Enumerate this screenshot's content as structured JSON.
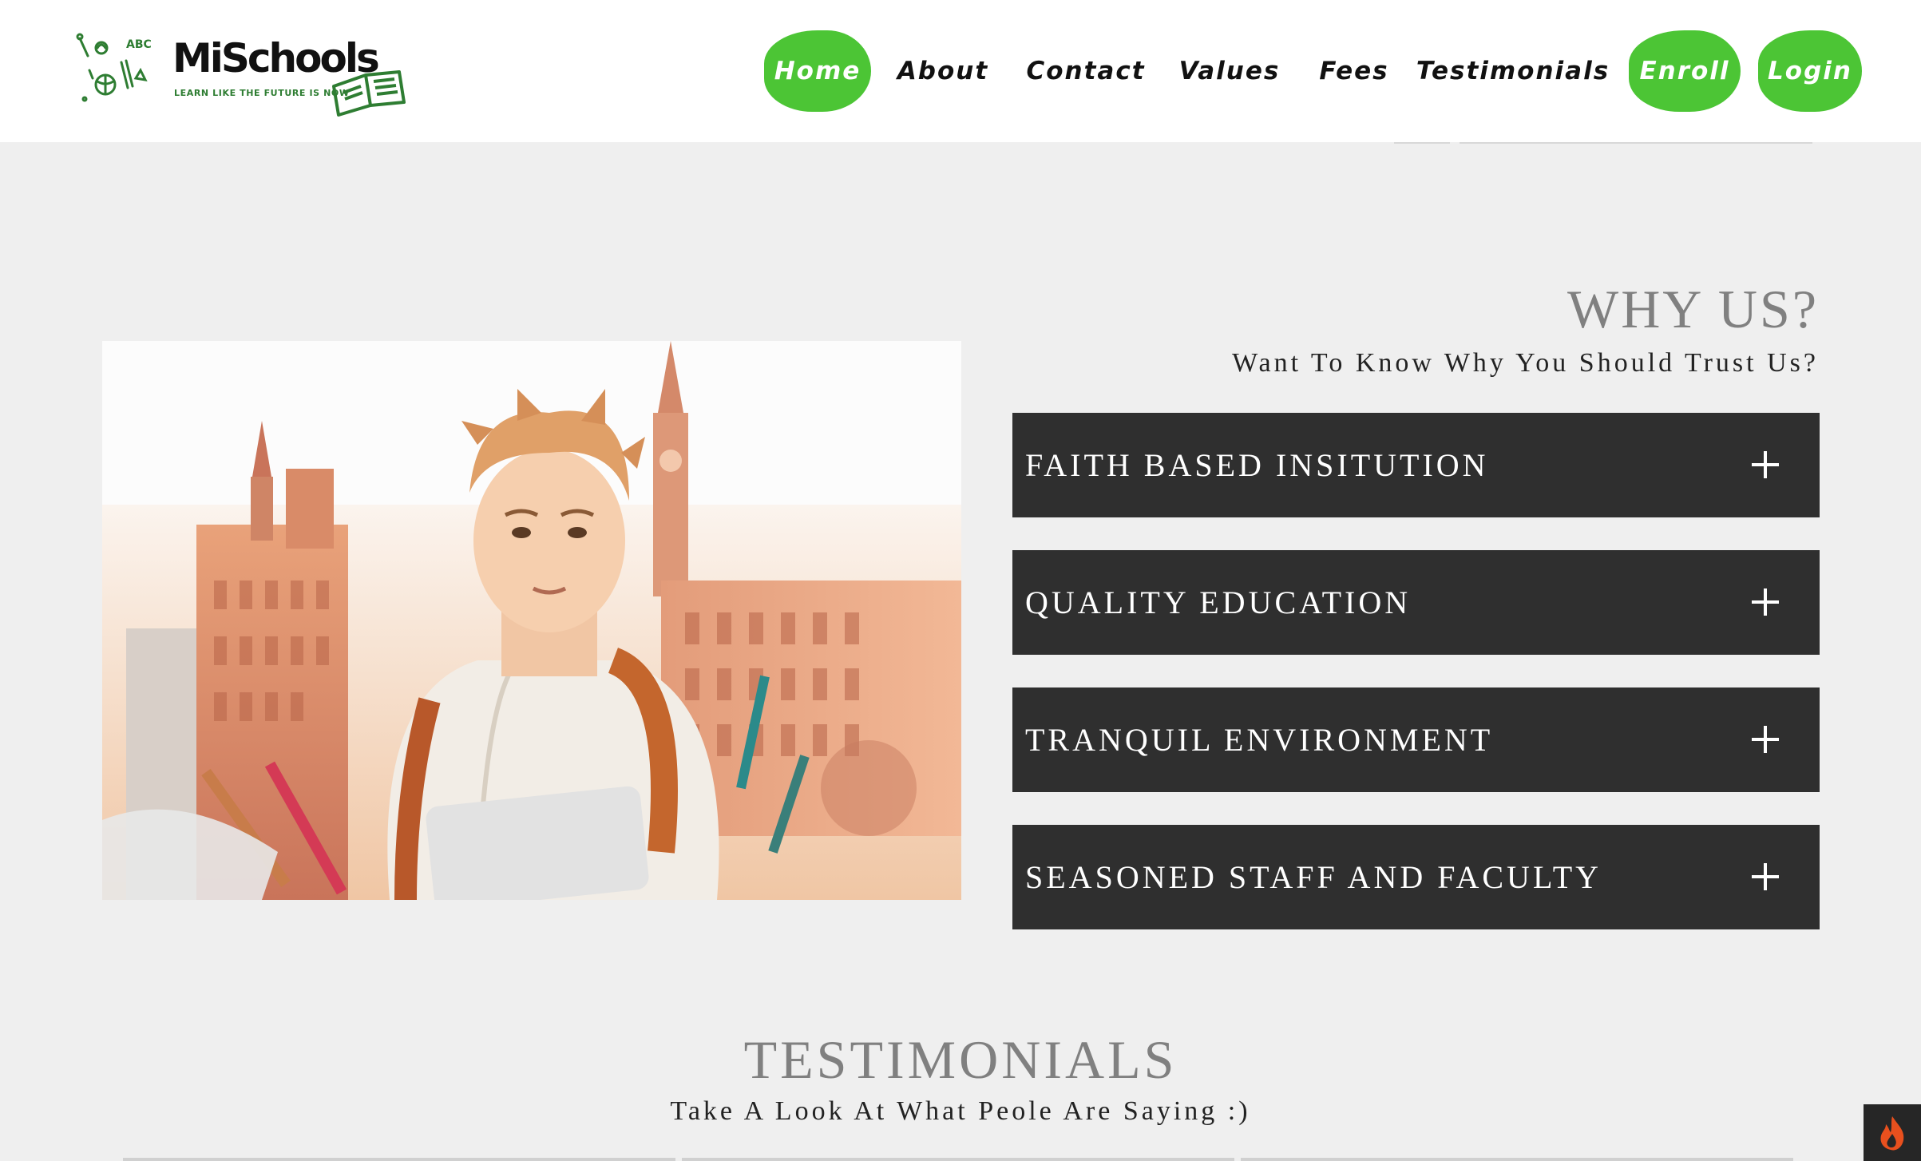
{
  "logo": {
    "name": "MiSchools",
    "tagline": "LEARN LIKE THE FUTURE IS NOW",
    "doodle_text": "ABC"
  },
  "nav": {
    "items": [
      {
        "label": "Home"
      },
      {
        "label": "About"
      },
      {
        "label": "Contact"
      },
      {
        "label": "Values"
      },
      {
        "label": "Fees"
      },
      {
        "label": "Testimonials"
      },
      {
        "label": "Enroll"
      },
      {
        "label": "Login"
      }
    ]
  },
  "why_us": {
    "title": "WHY US?",
    "subtitle": "Want To Know Why You Should Trust Us?",
    "items": [
      {
        "label": "FAITH BASED INSITUTION"
      },
      {
        "label": "QUALITY EDUCATION"
      },
      {
        "label": "TRANQUIL ENVIRONMENT"
      },
      {
        "label": "SEASONED STAFF AND FACULTY"
      }
    ]
  },
  "testimonials": {
    "title": "TESTIMONIALS",
    "subtitle": "Take A Look At What Peole Are Saying :)"
  },
  "colors": {
    "accent_green": "#4cc535",
    "accordion_bg": "#2f2f2f",
    "page_bg": "#efefef",
    "heading_gray": "#808080"
  },
  "icons": {
    "accordion": "plus-icon",
    "badge": "flame-icon"
  }
}
